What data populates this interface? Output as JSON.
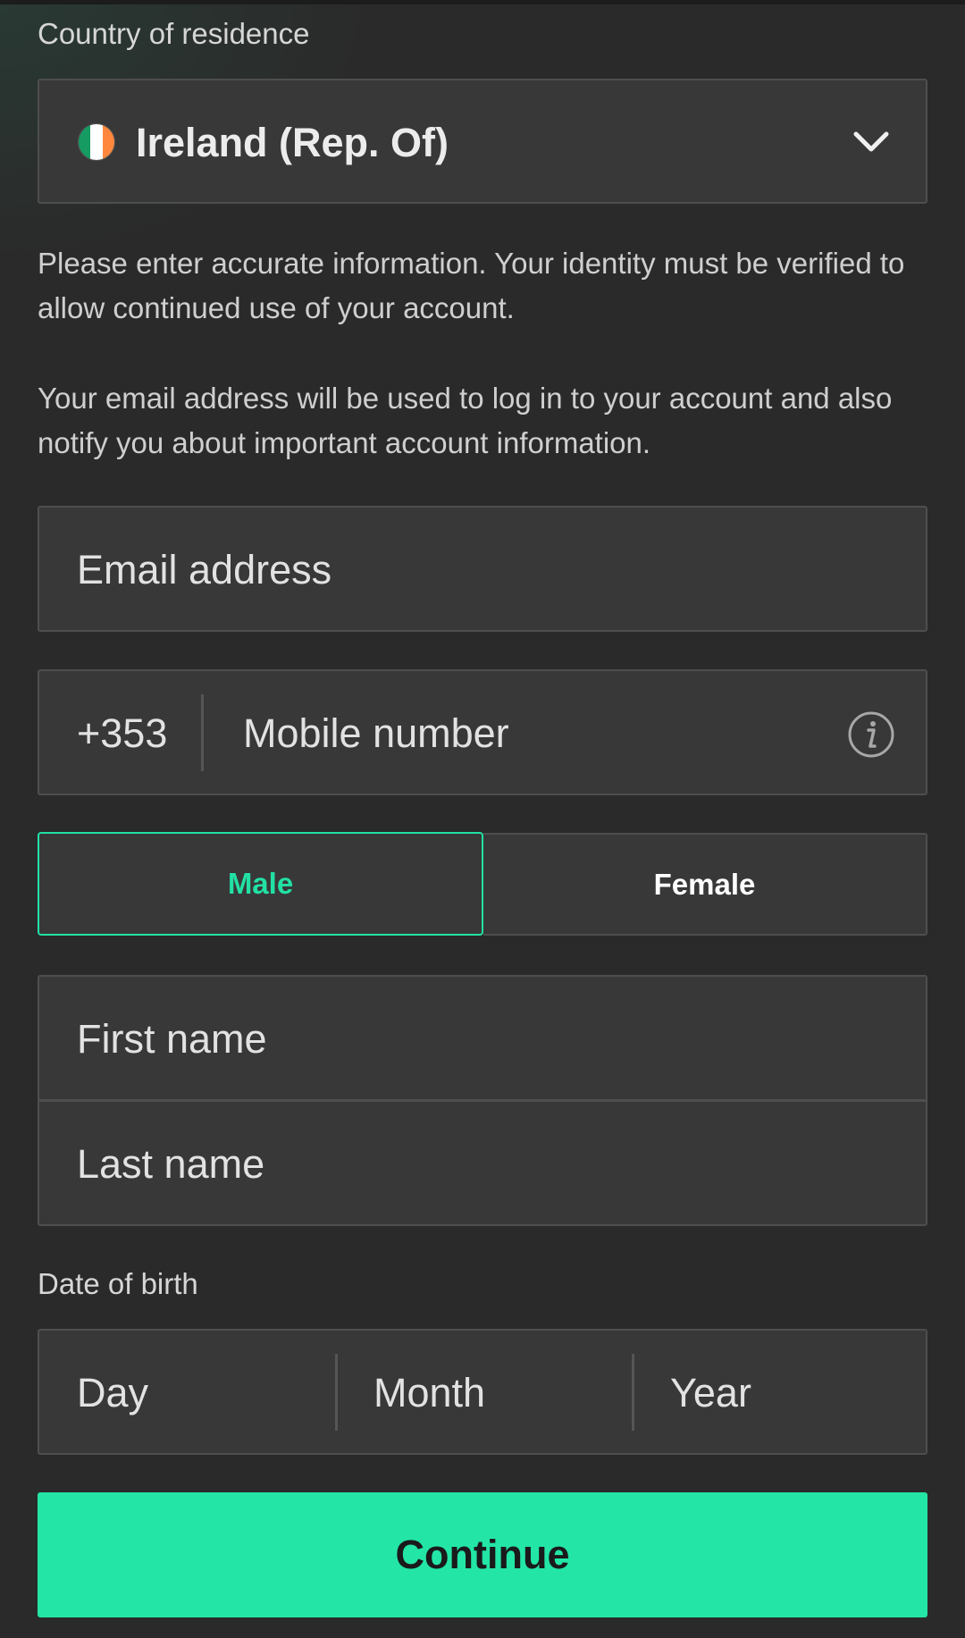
{
  "country": {
    "label": "Country of residence",
    "selected": "Ireland (Rep. Of)",
    "flag_colors": [
      "#169b62",
      "#ffffff",
      "#ff883e"
    ]
  },
  "info": {
    "identity_notice": "Please enter accurate information. Your identity must be verified to allow continued use of your account.",
    "email_notice": "Your email address will be used to log in to your account and also notify you about important account information."
  },
  "form": {
    "email_placeholder": "Email address",
    "phone_prefix": "+353",
    "mobile_placeholder": "Mobile number",
    "gender": {
      "male": "Male",
      "female": "Female",
      "selected": "Male"
    },
    "first_name_placeholder": "First name",
    "last_name_placeholder": "Last name",
    "dob_label": "Date of birth",
    "dob": {
      "day": "Day",
      "month": "Month",
      "year": "Year"
    },
    "continue_label": "Continue"
  },
  "colors": {
    "accent": "#22e0a4",
    "background": "#2a2a2a",
    "field_bg": "#383838"
  }
}
